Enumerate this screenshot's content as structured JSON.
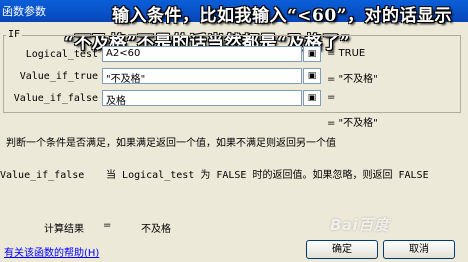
{
  "window": {
    "title": "函数参数"
  },
  "overlay": {
    "line1": "输入条件，比如我输入“<60”，对的话显示",
    "line2": "“不及格”不是的话当然都是“及格了”"
  },
  "function": {
    "name": "IF"
  },
  "args": [
    {
      "label": "Logical_test",
      "value": "A2<60",
      "result": "= TRUE"
    },
    {
      "label": "Value_if_true",
      "value": "\"不及格\"",
      "result": "= \"不及格\""
    },
    {
      "label": "Value_if_false",
      "value": "及格",
      "result": "="
    }
  ],
  "formula_result": "= \"不及格\"",
  "description": "判断一个条件是否满足，如果满足返回一个值，如果不满足则返回另一个值",
  "param_help": {
    "name": "Value_if_false",
    "text": "当 Logical_test 为 FALSE 时的返回值。如果忽略，则返回 FALSE"
  },
  "calc": {
    "label": "计算结果",
    "eq": "=",
    "value": "不及格"
  },
  "help_link": "有关该函数的帮助(H)",
  "buttons": {
    "ok": "确定",
    "cancel": "取消"
  },
  "watermark": "Bai百度"
}
